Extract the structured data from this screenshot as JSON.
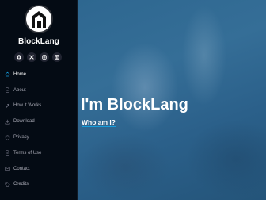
{
  "brand": {
    "name": "BlockLang",
    "logo_icon": "house-block-logo"
  },
  "socials": [
    {
      "icon": "facebook-icon"
    },
    {
      "icon": "x-twitter-icon"
    },
    {
      "icon": "instagram-icon"
    },
    {
      "icon": "linkedin-icon"
    }
  ],
  "nav": {
    "items": [
      {
        "label": "Home",
        "icon": "home-icon",
        "active": true
      },
      {
        "label": "About",
        "icon": "document-icon"
      },
      {
        "label": "How it Works",
        "icon": "hammer-icon"
      },
      {
        "label": "Download",
        "icon": "download-icon"
      },
      {
        "label": "Privacy",
        "icon": "shield-icon"
      },
      {
        "label": "Terms of Use",
        "icon": "document-icon"
      },
      {
        "label": "Contact",
        "icon": "envelope-icon"
      },
      {
        "label": "Credits",
        "icon": "tag-icon"
      }
    ]
  },
  "hero": {
    "title": "I'm BlockLang",
    "subtitle": "Who am I?"
  },
  "colors": {
    "sidebar_bg": "#040b14",
    "accent": "#149ddd",
    "nav_text": "#a8a9b4",
    "hero_bg": "#2e6790"
  }
}
